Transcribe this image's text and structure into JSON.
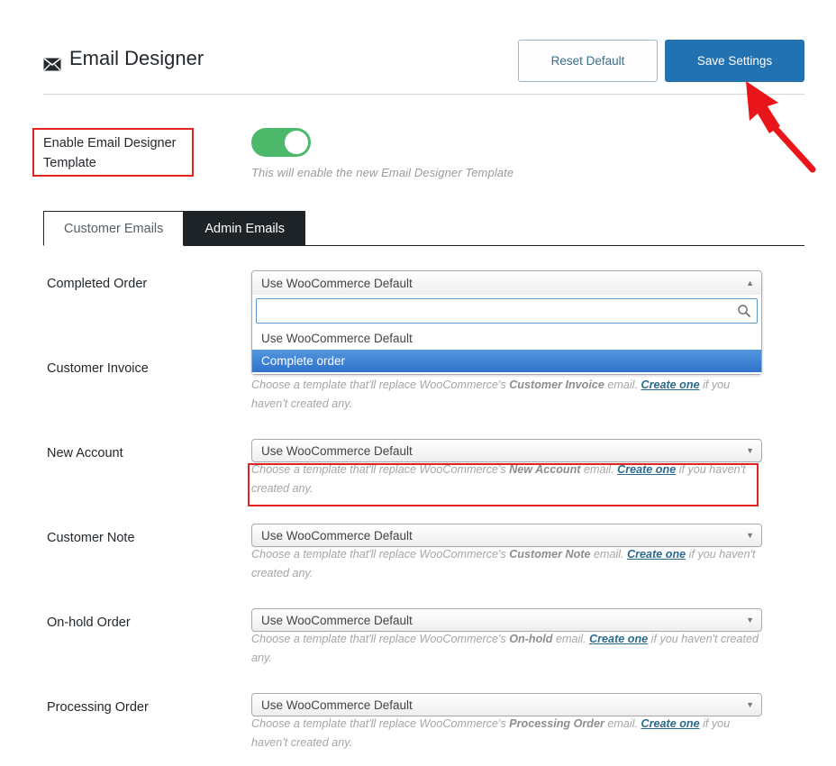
{
  "header": {
    "title": "Email Designer",
    "title_icon": "envelope-icon",
    "reset_label": "Reset Default",
    "save_label": "Save Settings",
    "accent_color": "#2271b1",
    "annotation_color": "#e02424"
  },
  "enable": {
    "label": "Enable Email Designer Template",
    "toggle_state": "on",
    "toggle_color": "#4cb86a",
    "description": "This will enable the new Email Designer Template"
  },
  "tabs": [
    {
      "label": "Customer Emails",
      "active": true
    },
    {
      "label": "Admin Emails",
      "active": false
    }
  ],
  "dropdown_open": {
    "header_value": "Use WooCommerce Default",
    "search_value": "",
    "search_placeholder": "",
    "caret": "up",
    "options": [
      {
        "label": "Use WooCommerce Default",
        "selected": false
      },
      {
        "label": "Complete order",
        "selected": true
      }
    ],
    "highlight_color": "#2e72cc"
  },
  "rows": [
    {
      "label": "Completed Order",
      "value": "Use WooCommerce Default",
      "open": true,
      "help_prefix": "",
      "help_strong": "",
      "help_mid": "",
      "help_link": "",
      "help_suffix": "",
      "highlighted": false
    },
    {
      "label": "Customer Invoice",
      "value": "Use WooCommerce Default",
      "open": false,
      "help_prefix": "Choose a template that'll replace WooCommerce's ",
      "help_strong": "Customer Invoice",
      "help_mid": " email. ",
      "help_link": "Create one",
      "help_suffix": " if you haven't created any.",
      "highlighted": false
    },
    {
      "label": "New Account",
      "value": "Use WooCommerce Default",
      "open": false,
      "help_prefix": "Choose a template that'll replace WooCommerce's ",
      "help_strong": "New Account",
      "help_mid": " email. ",
      "help_link": "Create one",
      "help_suffix": " if you haven't created any.",
      "highlighted": true
    },
    {
      "label": "Customer Note",
      "value": "Use WooCommerce Default",
      "open": false,
      "help_prefix": "Choose a template that'll replace WooCommerce's ",
      "help_strong": "Customer Note",
      "help_mid": " email. ",
      "help_link": "Create one",
      "help_suffix": " if you haven't created any.",
      "highlighted": false
    },
    {
      "label": "On-hold Order",
      "value": "Use WooCommerce Default",
      "open": false,
      "help_prefix": "Choose a template that'll replace WooCommerce's ",
      "help_strong": "On-hold",
      "help_mid": " email. ",
      "help_link": "Create one",
      "help_suffix": " if you haven't created any.",
      "highlighted": false
    },
    {
      "label": "Processing Order",
      "value": "Use WooCommerce Default",
      "open": false,
      "help_prefix": "Choose a template that'll replace WooCommerce's ",
      "help_strong": "Processing Order",
      "help_mid": " email. ",
      "help_link": "Create one",
      "help_suffix": " if you haven't created any.",
      "highlighted": false
    }
  ],
  "annotations": {
    "arrow": "red-arrow-pointing-to-save-settings",
    "boxes": [
      "enable-email-designer-template-label",
      "new-account-help-text"
    ]
  }
}
